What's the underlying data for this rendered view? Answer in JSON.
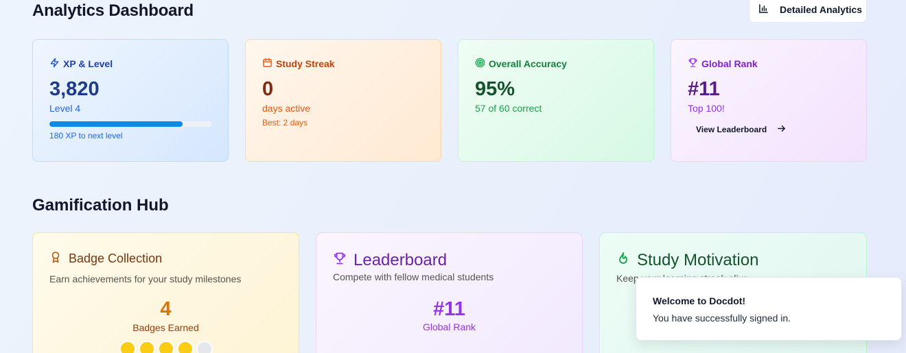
{
  "header": {
    "title": "Analytics Dashboard",
    "detailed_button": "Detailed Analytics"
  },
  "stats": {
    "xp": {
      "label": "XP & Level",
      "value": "3,820",
      "level": "Level 4",
      "progress_fraction": 0.82,
      "note": "180 XP to next level"
    },
    "streak": {
      "label": "Study Streak",
      "value": "0",
      "sub": "days active",
      "note": "Best: 2 days"
    },
    "accuracy": {
      "label": "Overall Accuracy",
      "value": "95%",
      "sub": "57 of 60 correct"
    },
    "rank": {
      "label": "Global Rank",
      "value": "#11",
      "sub": "Top 100!",
      "link": "View Leaderboard"
    }
  },
  "hub": {
    "title": "Gamification Hub",
    "badges": {
      "title": "Badge Collection",
      "desc": "Earn achievements for your study milestones",
      "count": "4",
      "count_label": "Badges Earned"
    },
    "leaderboard": {
      "title": "Leaderboard",
      "desc": "Compete with fellow medical students",
      "rank": "#11",
      "rank_label": "Global Rank"
    },
    "motivation": {
      "title": "Study Motivation",
      "desc": "Keep your learning streak alive"
    }
  },
  "toast": {
    "title": "Welcome to Docdot!",
    "message": "You have successfully signed in."
  },
  "icons": {
    "detailed": "bar-chart-icon",
    "xp": "zap-icon",
    "streak": "calendar-icon",
    "accuracy": "target-icon",
    "rank": "trophy-icon",
    "badges": "award-icon",
    "leaderboard": "trophy-icon",
    "motivation": "flame-icon",
    "arrow": "arrow-right-icon"
  }
}
